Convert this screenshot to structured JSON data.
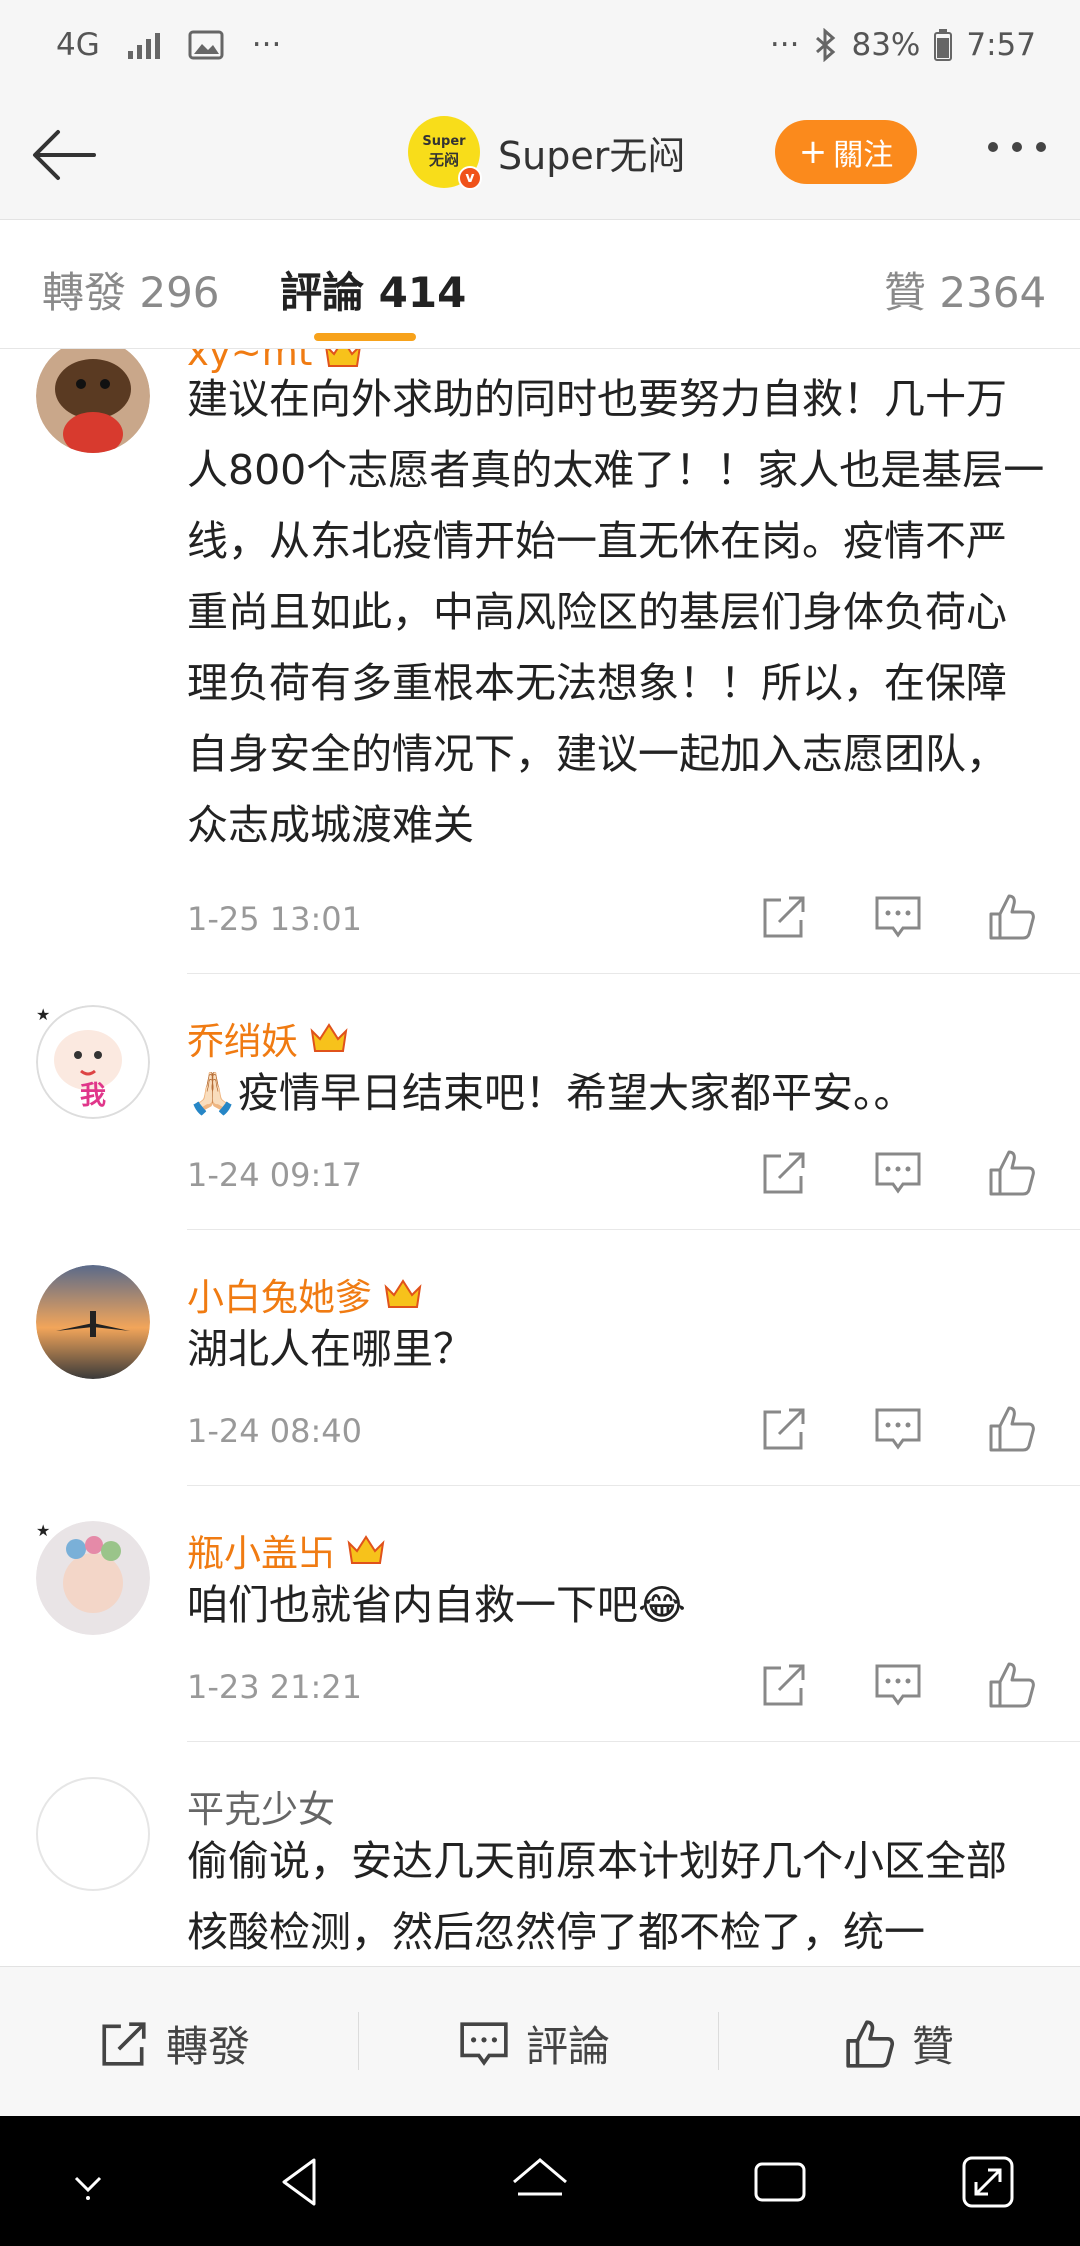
{
  "status_bar": {
    "network": "4G",
    "more_left": "···",
    "more_right": "···",
    "battery": "83%",
    "time": "7:57"
  },
  "header": {
    "title": "Super无闷",
    "follow_label": "關注",
    "logo_text_top": "Super",
    "logo_text_bottom": "无闷"
  },
  "tabs": [
    {
      "label": "轉發 296"
    },
    {
      "label": "評論 414"
    },
    {
      "label": "贊 2364"
    }
  ],
  "comments": [
    {
      "username": "xy~mt",
      "verified": false,
      "text": "建议在向外求助的同时也要努力自救！几十万人800个志愿者真的太难了！！家人也是基层一线，从东北疫情开始一直无休在岗。疫情不严重尚且如此，中高风险区的基层们身体负荷心理负荷有多重根本无法想象！！所以，在保障自身安全的情况下，建议一起加入志愿团队，众志成城渡难关",
      "time": "1-25 13:01"
    },
    {
      "username": "乔绡妖",
      "verified": true,
      "avatar_text": "我",
      "text": "🙏🏻疫情早日结束吧！希望大家都平安。。",
      "time": "1-24 09:17"
    },
    {
      "username": "小白兔她爹",
      "verified": false,
      "text": "湖北人在哪里？",
      "time": "1-24 08:40"
    },
    {
      "username": "瓶小盖卐",
      "verified": true,
      "text": "咱们也就省内自救一下吧😂",
      "time": "1-23 21:21"
    },
    {
      "username": "平克少女",
      "verified": false,
      "text": "偷偷说，安达几天前原本计划好几个小区全部核酸检测，然后忽然停了都不检了，统一",
      "time": ""
    }
  ],
  "action_bar": {
    "repost_label": "轉發",
    "comment_label": "評論",
    "like_label": "贊"
  },
  "colors": {
    "accent_orange": "#fb8a1c",
    "username_orange": "#f07b12",
    "tab_underline": "#f7a21b"
  }
}
